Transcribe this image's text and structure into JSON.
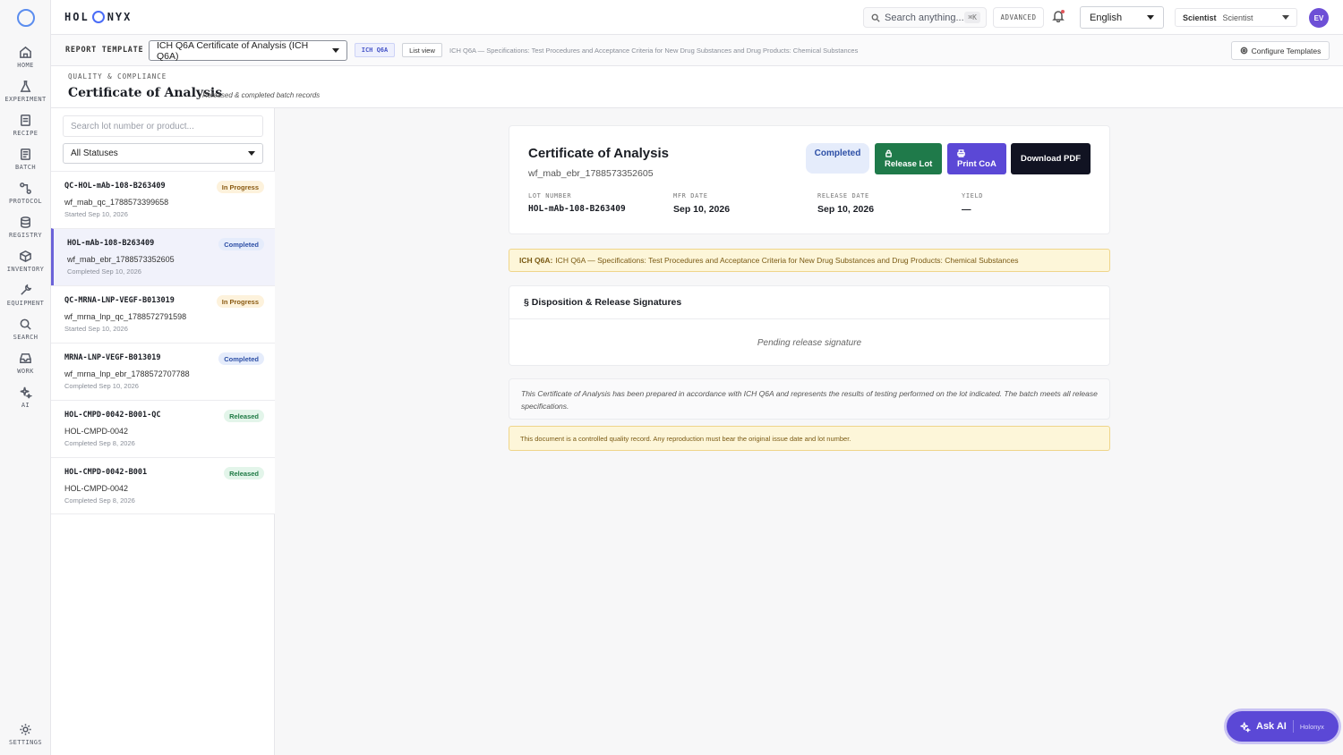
{
  "colors": {
    "accent": "#5b48d6",
    "release": "#1f7a4a",
    "dark": "#111322",
    "completed_bg": "#e5ecfb",
    "warning_bg": "#fdf6d9"
  },
  "rail": {
    "items": [
      {
        "label": "HOME",
        "icon": "home-icon"
      },
      {
        "label": "EXPERIMENT",
        "icon": "flask-icon"
      },
      {
        "label": "RECIPE",
        "icon": "recipe-icon"
      },
      {
        "label": "BATCH",
        "icon": "batch-icon"
      },
      {
        "label": "PROTOCOL",
        "icon": "protocol-icon"
      },
      {
        "label": "REGISTRY",
        "icon": "database-icon"
      },
      {
        "label": "INVENTORY",
        "icon": "box-icon"
      },
      {
        "label": "EQUIPMENT",
        "icon": "wrench-icon"
      },
      {
        "label": "SEARCH",
        "icon": "search-icon"
      },
      {
        "label": "WORK",
        "icon": "inbox-icon"
      },
      {
        "label": "AI",
        "icon": "sparkles-icon"
      }
    ],
    "settings": {
      "label": "SETTINGS",
      "icon": "gear-icon"
    }
  },
  "header": {
    "brand_left": "HOL",
    "brand_right": "NYX",
    "search_placeholder": "Search anything...",
    "search_shortcut": "⌘K",
    "advanced_label": "ADVANCED",
    "language": "English",
    "role_label": "Scientist",
    "role_value": "Scientist",
    "avatar_initials": "EV"
  },
  "template_bar": {
    "label": "REPORT TEMPLATE",
    "selected": "ICH Q6A Certificate of Analysis (ICH Q6A)",
    "tag": "ICH Q6A",
    "list_view": "List view",
    "description": "ICH Q6A — Specifications: Test Procedures and Acceptance Criteria for New Drug Substances and Drug Products: Chemical Substances",
    "configure": "Configure Templates"
  },
  "page": {
    "eyebrow": "QUALITY & COMPLIANCE",
    "title": "Certificate of Analysis",
    "subtitle": "Released & completed batch records"
  },
  "lots": {
    "search_placeholder": "Search lot number or product...",
    "status_filter": "All Statuses",
    "items": [
      {
        "id": "QC-HOL-mAb-108-B263409",
        "product": "wf_mab_qc_1788573399658",
        "date": "Started Sep 10, 2026",
        "status": "In Progress"
      },
      {
        "id": "HOL-mAb-108-B263409",
        "product": "wf_mab_ebr_1788573352605",
        "date": "Completed Sep 10, 2026",
        "status": "Completed"
      },
      {
        "id": "QC-MRNA-LNP-VEGF-B013019",
        "product": "wf_mrna_lnp_qc_1788572791598",
        "date": "Started Sep 10, 2026",
        "status": "In Progress"
      },
      {
        "id": "MRNA-LNP-VEGF-B013019",
        "product": "wf_mrna_lnp_ebr_1788572707788",
        "date": "Completed Sep 10, 2026",
        "status": "Completed"
      },
      {
        "id": "HOL-CMPD-0042-B001-QC",
        "product": "HOL-CMPD-0042",
        "date": "Completed Sep 8, 2026",
        "status": "Released"
      },
      {
        "id": "HOL-CMPD-0042-B001",
        "product": "HOL-CMPD-0042",
        "date": "Completed Sep 8, 2026",
        "status": "Released"
      }
    ]
  },
  "coa": {
    "title": "Certificate of Analysis",
    "subtitle": "wf_mab_ebr_1788573352605",
    "status": "Completed",
    "release_btn": "Release Lot",
    "print_btn": "Print CoA",
    "download_btn": "Download PDF",
    "meta": {
      "lot_label": "LOT NUMBER",
      "lot_value": "HOL-mAb-108-B263409",
      "mfr_label": "MFR DATE",
      "mfr_value": "Sep 10, 2026",
      "release_label": "RELEASE DATE",
      "release_value": "Sep 10, 2026",
      "yield_label": "YIELD",
      "yield_value": "—"
    },
    "ich_prefix": "ICH Q6A:",
    "ich_text": "ICH Q6A — Specifications: Test Procedures and Acceptance Criteria for New Drug Substances and Drug Products: Chemical Substances",
    "disposition_title": "§ Disposition & Release Signatures",
    "disposition_body": "Pending release signature",
    "statement": "This Certificate of Analysis has been prepared in accordance with ICH Q6A and represents the results of testing performed on the lot indicated. The batch meets all release specifications.",
    "controlled_notice": "This document is a controlled quality record. Any reproduction must bear the original issue date and lot number."
  },
  "ask_ai": {
    "label": "Ask AI",
    "brand": "Holonyx"
  }
}
